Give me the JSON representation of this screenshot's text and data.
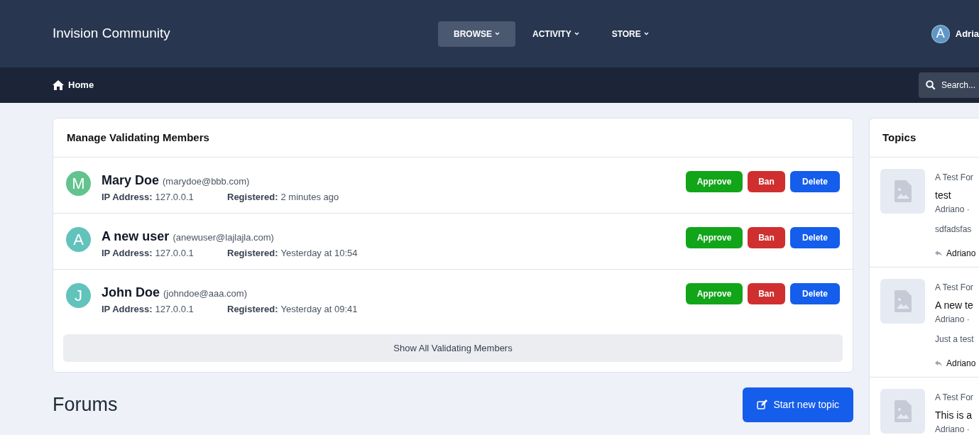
{
  "header": {
    "site_title": "Invision Community",
    "nav": [
      {
        "label": "BROWSE",
        "selected": true
      },
      {
        "label": "ACTIVITY",
        "selected": false
      },
      {
        "label": "STORE",
        "selected": false
      }
    ],
    "user": {
      "avatar_letter": "A",
      "name": "Adria"
    }
  },
  "breadcrumb": {
    "label": "Home"
  },
  "search": {
    "placeholder": "Search..."
  },
  "validating": {
    "title": "Manage Validating Members",
    "members": [
      {
        "letter": "M",
        "color": "#62c38e",
        "name": "Mary Doe",
        "email": "(marydoe@bbb.com)",
        "ip_label": "IP Address:",
        "ip": "127.0.0.1",
        "registered_label": "Registered:",
        "registered": "2 minutes ago",
        "actions": [
          "Approve",
          "Ban",
          "Delete"
        ]
      },
      {
        "letter": "A",
        "color": "#62c3bc",
        "name": "A new user",
        "email": "(anewuser@lajlajla.com)",
        "ip_label": "IP Address:",
        "ip": "127.0.0.1",
        "registered_label": "Registered:",
        "registered": "Yesterday at 10:54",
        "actions": [
          "Approve",
          "Ban",
          "Delete"
        ]
      },
      {
        "letter": "J",
        "color": "#62c3bc",
        "name": "John Doe",
        "email": "(johndoe@aaa.com)",
        "ip_label": "IP Address:",
        "ip": "127.0.0.1",
        "registered_label": "Registered:",
        "registered": "Yesterday at 09:41",
        "actions": [
          "Approve",
          "Ban",
          "Delete"
        ]
      }
    ],
    "show_all": "Show All Validating Members"
  },
  "forums": {
    "title": "Forums",
    "new_topic": "Start new topic"
  },
  "topics": {
    "title": "Topics",
    "items": [
      {
        "forum": "A Test For",
        "title": "test",
        "meta": "Adriano ·",
        "snippet": "sdfadsfas",
        "reply": "Adriano"
      },
      {
        "forum": "A Test For",
        "title": "A new te",
        "meta": "Adriano ·",
        "snippet": "Just a test",
        "reply": "Adriano"
      },
      {
        "forum": "A Test For",
        "title": "This is a",
        "meta": "Adriano ·"
      }
    ]
  }
}
